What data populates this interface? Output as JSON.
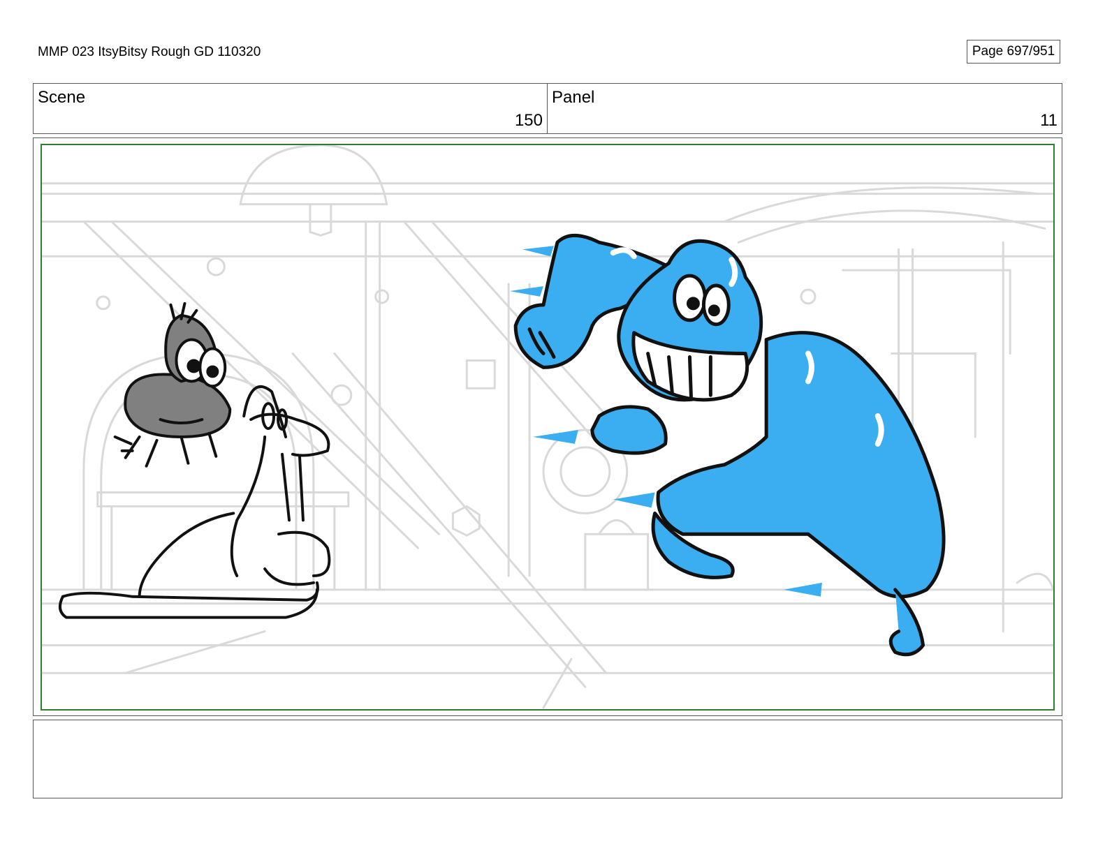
{
  "document": {
    "title": "MMP 023 ItsyBitsy Rough GD 110320",
    "page_label": "Page 697/951"
  },
  "header": {
    "scene_label": "Scene",
    "scene_number": "150",
    "panel_label": "Panel",
    "panel_number": "11"
  },
  "panel": {
    "frame_color": "#2e7d32",
    "background_line_color": "#d9d9d9",
    "character_fill_blue": "#3aaef0",
    "character_fill_gray": "#808080"
  },
  "notes": {
    "text": ""
  }
}
